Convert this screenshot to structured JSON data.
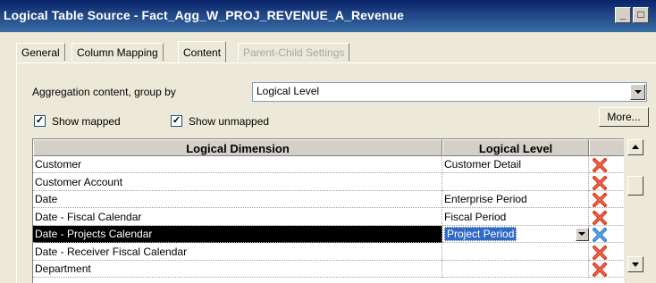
{
  "window": {
    "title": "Logical Table Source - Fact_Agg_W_PROJ_REVENUE_A_Revenue"
  },
  "tabs": [
    {
      "label": "General",
      "active": false,
      "enabled": true
    },
    {
      "label": "Column Mapping",
      "active": false,
      "enabled": true
    },
    {
      "label": "Content",
      "active": true,
      "enabled": true
    },
    {
      "label": "Parent-Child Settings",
      "active": false,
      "enabled": false
    }
  ],
  "content": {
    "aggregation_label": "Aggregation content, group by",
    "aggregation_value": "Logical Level",
    "show_mapped": {
      "label": "Show mapped",
      "checked": true
    },
    "show_unmapped": {
      "label": "Show unmapped",
      "checked": true
    },
    "more_button": "More..."
  },
  "table": {
    "columns": [
      "Logical Dimension",
      "Logical Level"
    ],
    "rows": [
      {
        "dimension": "Customer",
        "level": "Customer Detail"
      },
      {
        "dimension": "Customer Account",
        "level": ""
      },
      {
        "dimension": "Date",
        "level": "Enterprise Period"
      },
      {
        "dimension": "Date - Fiscal Calendar",
        "level": "Fiscal Period"
      },
      {
        "dimension": "Date - Projects Calendar",
        "level": "Project Period"
      },
      {
        "dimension": "Date - Receiver Fiscal Calendar",
        "level": ""
      },
      {
        "dimension": "Department",
        "level": ""
      }
    ],
    "selected_row": 4
  },
  "colors": {
    "titlebar": "#0a246a",
    "selection": "#3169c6",
    "delete_red": "#e03b1d",
    "delete_blue": "#2f83d6"
  },
  "icons": {
    "delete": "red-x-icon",
    "delete_selected": "blue-x-icon"
  }
}
